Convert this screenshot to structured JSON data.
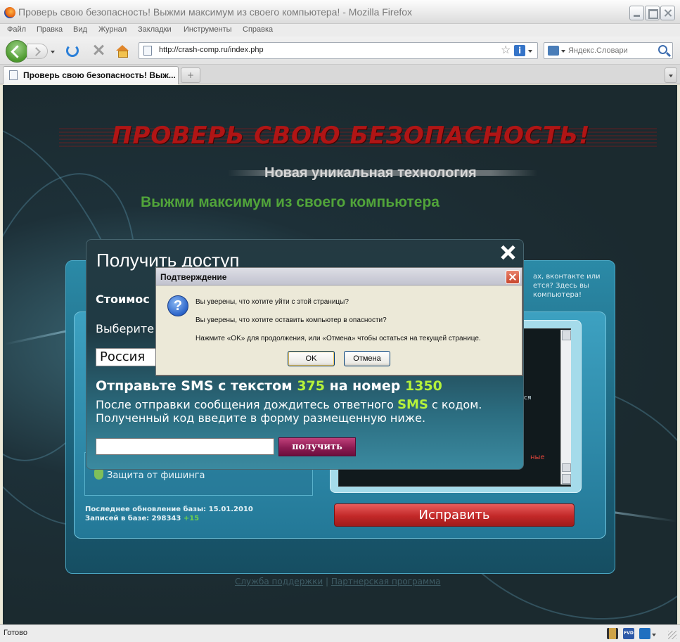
{
  "window": {
    "title": "Проверь свою безопасность! Выжми максимум из своего компьютера! - Mozilla Firefox"
  },
  "menu": [
    "Файл",
    "Правка",
    "Вид",
    "Журнал",
    "Закладки",
    "Инструменты",
    "Справка"
  ],
  "nav": {
    "url": "http://crash-comp.ru/index.php",
    "search_placeholder": "Яндекс.Словари"
  },
  "tabs": [
    {
      "label": "Проверь свою безопасность! Выж..."
    }
  ],
  "page": {
    "headline": "ПРОВЕРЬ СВОЮ БЕЗОПАСНОСТЬ!",
    "subtitle1": "Новая уникальная технология",
    "subtitle2": "Выжми максимум из своего компьютера",
    "behind_text": [
      "ах, вконтакте или",
      "ется? Здесь вы",
      "компьютера!"
    ],
    "behind_small": "ся",
    "behind_red": "ные",
    "phishing": "Защита от фишинга",
    "db_update": "Последнее обновление базы: 15.01.2010",
    "db_records_label": "Записей в базе: 298343",
    "db_records_plus": "+15",
    "fix_button": "Исправить",
    "footer_support": "Служба поддержки",
    "footer_sep": "|",
    "footer_partner": "Партнерская программа"
  },
  "popup": {
    "title": "Получить доступ",
    "cost": "Стоимос",
    "choose": "Выберите",
    "country": "Россия",
    "sms_prefix": "Отправьте SMS с текстом",
    "sms_code": "375",
    "sms_mid": "на номер",
    "sms_number": "1350",
    "info_line1_a": "После отправки сообщения дождитесь ответного",
    "info_line1_sms": "SMS",
    "info_line1_b": "с кодом.",
    "info_line2": "Полученный код введите в форму размещенную ниже.",
    "code_value": "",
    "get_button": "получить"
  },
  "dialog": {
    "title": "Подтверждение",
    "icon_glyph": "?",
    "line1": "Вы уверены, что хотите уйти с этой страницы?",
    "line2": "Вы уверены, что хотите оставить компьютер в опасности?",
    "line3": "Нажмите «OK» для продолжения, или «Отмена» чтобы остаться на текущей странице.",
    "ok": "OK",
    "cancel": "Отмена"
  },
  "status": {
    "text": "Готово",
    "fvd_label": "FVD"
  }
}
